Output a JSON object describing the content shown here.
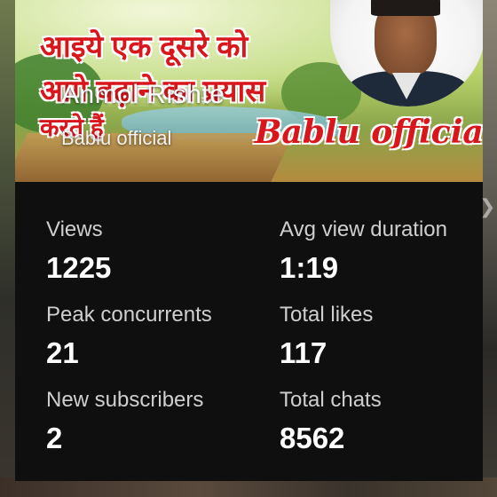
{
  "thumbnail": {
    "hindi_lines": [
      "आइये एक दूसरे को",
      "आगे बढ़ाने का प्रयास",
      "करते हैं"
    ],
    "brand": "Bablu official"
  },
  "video": {
    "title": "Anmol Rishte",
    "channel": "Bablu official"
  },
  "stats": [
    {
      "label": "Views",
      "value": "1225"
    },
    {
      "label": "Avg view duration",
      "value": "1:19"
    },
    {
      "label": "Peak concurrents",
      "value": "21"
    },
    {
      "label": "Total likes",
      "value": "117"
    },
    {
      "label": "New subscribers",
      "value": "2"
    },
    {
      "label": "Total chats",
      "value": "8562"
    }
  ]
}
